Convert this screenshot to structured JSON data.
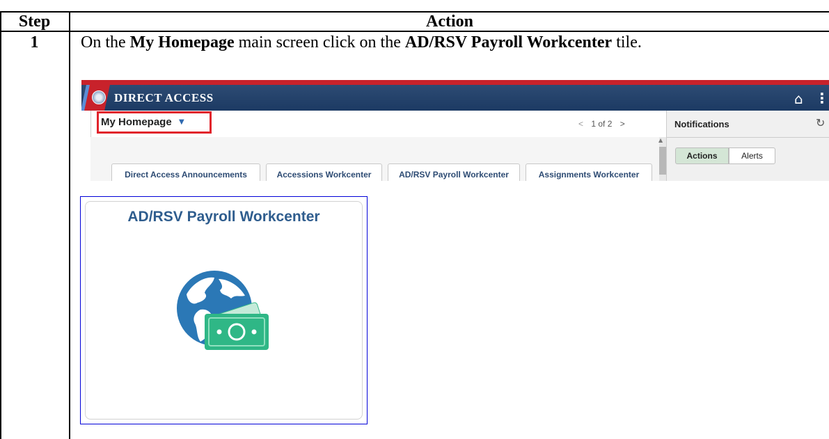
{
  "table": {
    "headers": {
      "step": "Step",
      "action": "Action"
    },
    "rows": [
      {
        "step": "1",
        "instruction": {
          "prefix": "On the ",
          "bold1": "My Homepage",
          "middle": " main screen click on the ",
          "bold2": "AD/RSV Payroll Workcenter",
          "suffix": " tile."
        }
      }
    ]
  },
  "screenshot": {
    "app_title": "DIRECT ACCESS",
    "icons": {
      "logo": "coast-guard-seal-icon",
      "home": "home-icon",
      "more": "more-vertical-icon",
      "refresh": "refresh-icon",
      "caret": "caret-down-icon"
    },
    "homepage_label": "My Homepage",
    "pager": {
      "prev": "<",
      "text": "1 of 2",
      "next": ">"
    },
    "tabs": [
      "Direct Access Announcements",
      "Accessions Workcenter",
      "AD/RSV Payroll Workcenter",
      "Assignments Workcenter"
    ],
    "notifications": {
      "title": "Notifications",
      "segments": [
        "Actions",
        "Alerts"
      ],
      "selected": "Actions"
    },
    "colors": {
      "banner": "#1c3a63",
      "accent_red": "#c8222b",
      "highlight_box": "#e1232b",
      "tab_text": "#2d4b73"
    }
  },
  "tile": {
    "title": "AD/RSV Payroll Workcenter",
    "icon": "globe-money-icon",
    "colors": {
      "globe": "#2b78b6",
      "money": "#2fb786",
      "frame": "#0000d8"
    }
  }
}
